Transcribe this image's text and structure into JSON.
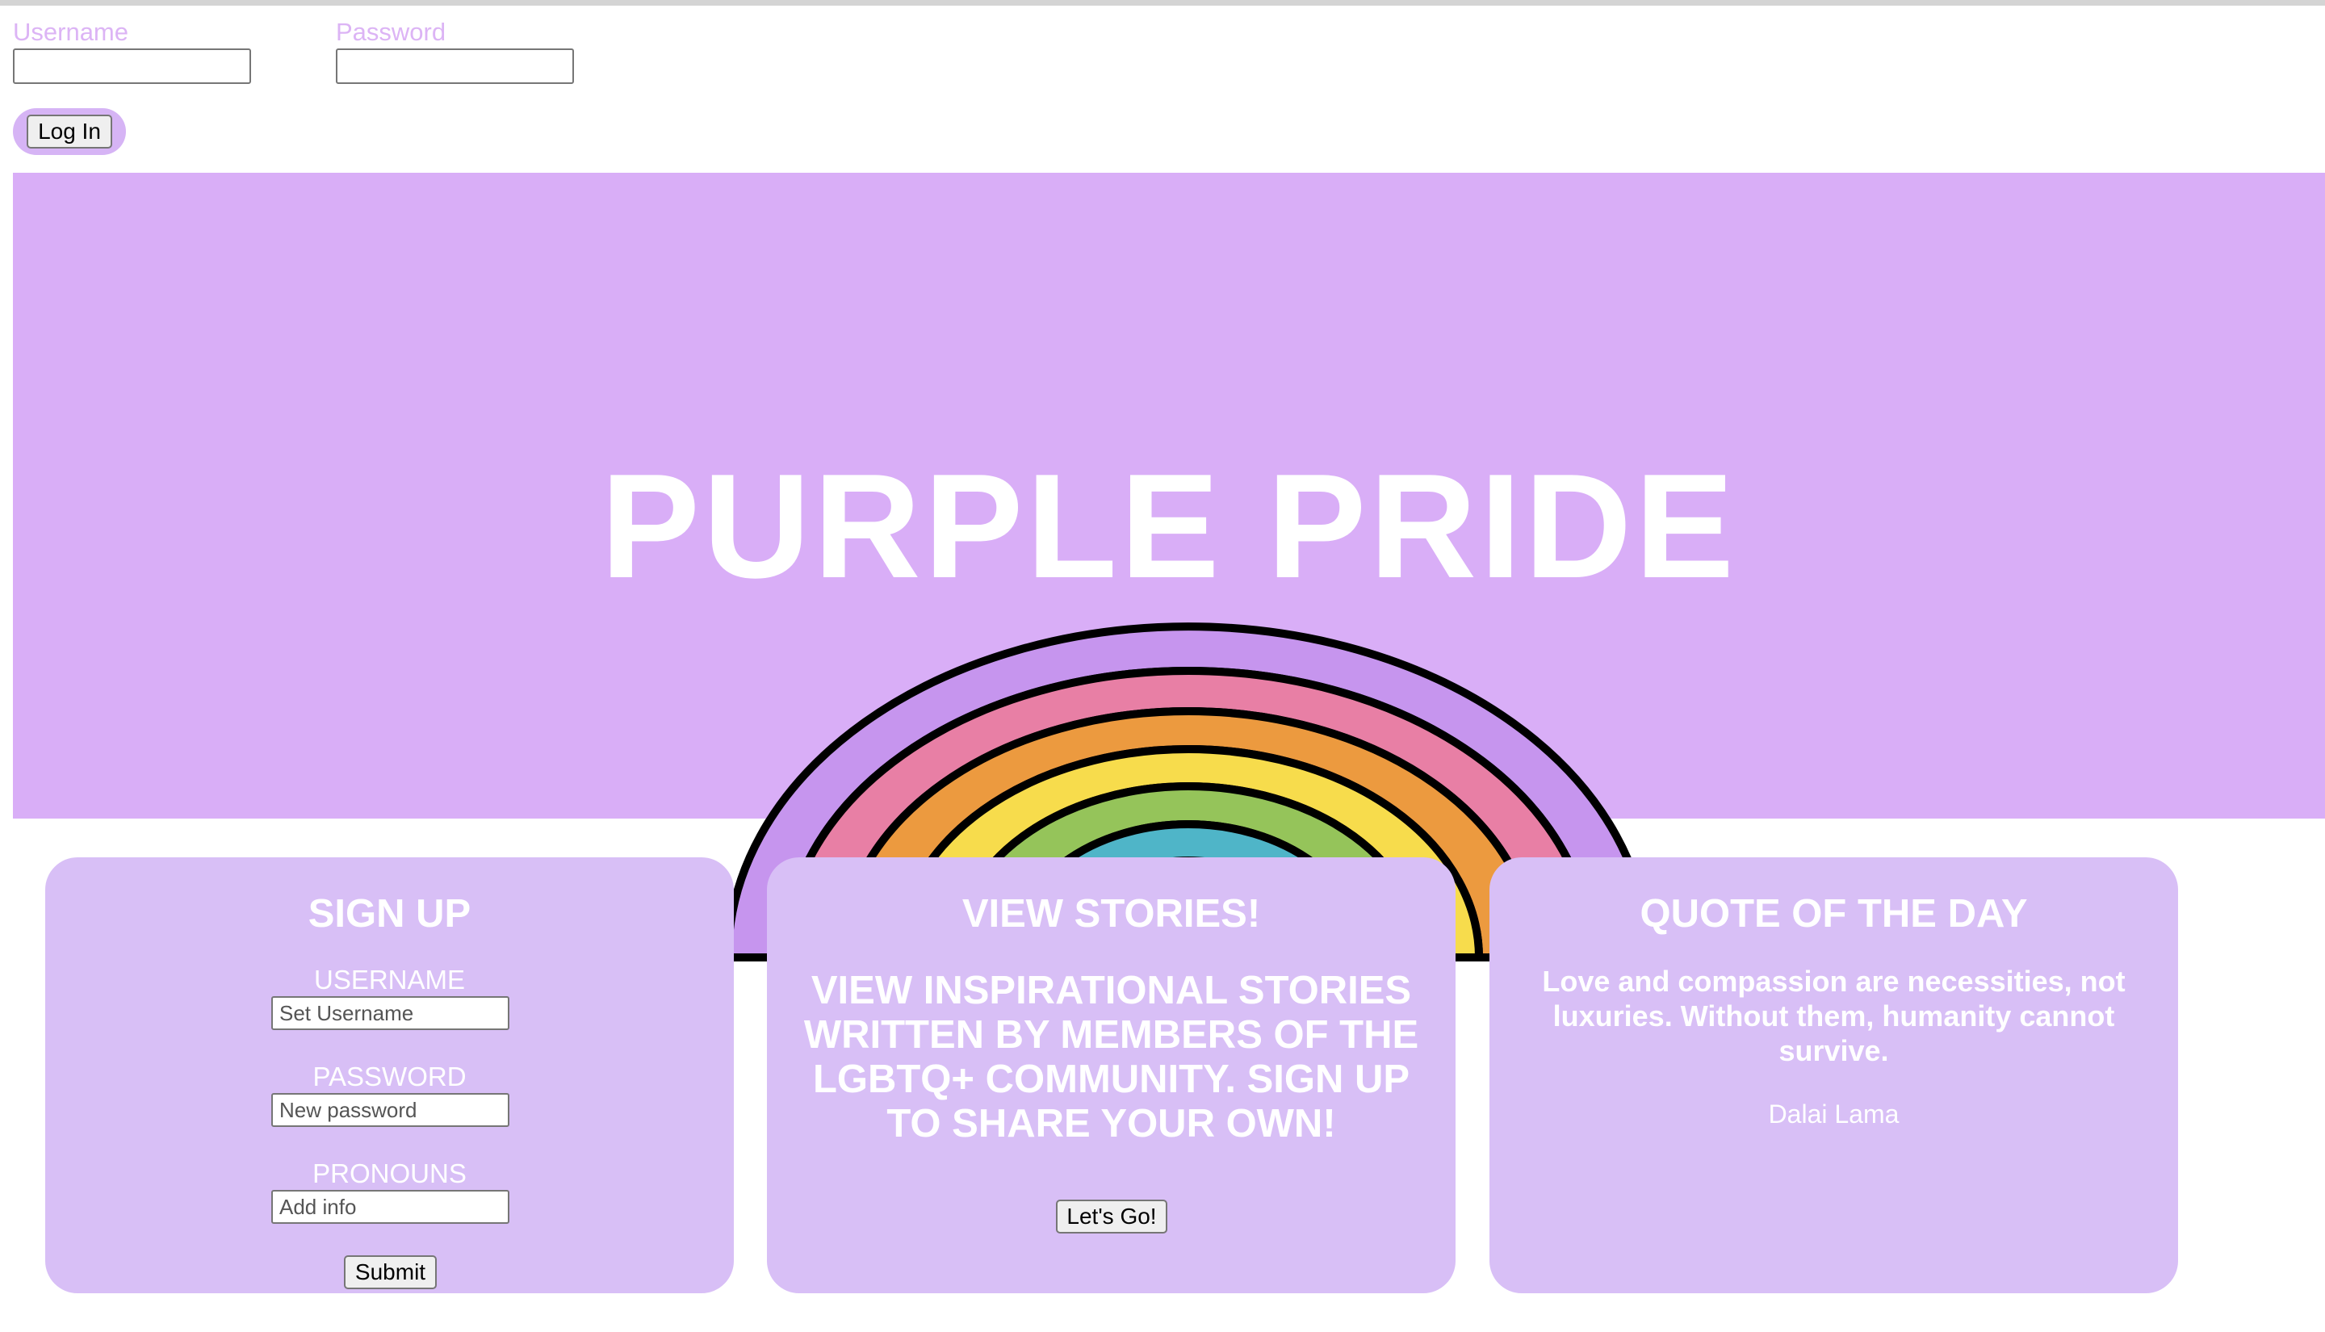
{
  "login": {
    "username_label": "Username",
    "password_label": "Password",
    "username_value": "",
    "password_value": "",
    "login_button": "Log In"
  },
  "hero": {
    "title": "PURPLE PRIDE",
    "image_icon": "rainbow-icon",
    "background_color": "#d9aef7"
  },
  "signup": {
    "title": "SIGN UP",
    "username_label": "USERNAME",
    "username_placeholder": "Set Username",
    "password_label": "PASSWORD",
    "password_placeholder": "New password",
    "pronouns_label": "PRONOUNS",
    "pronouns_placeholder": "Add info",
    "submit_button": "Submit"
  },
  "stories": {
    "title": "VIEW STORIES!",
    "text": "VIEW INSPIRATIONAL STORIES WRITTEN BY MEMBERS OF THE LGBTQ+ COMMUNITY. SIGN UP TO SHARE YOUR OWN!",
    "button": "Let's Go!"
  },
  "quote": {
    "title": "QUOTE OF THE DAY",
    "text": "Love and compassion are necessities, not luxuries. Without them, humanity cannot survive.",
    "author": "Dalai Lama"
  },
  "colors": {
    "accent": "#d9aef7",
    "card": "#d8bff6",
    "label": "#dcb4f5"
  }
}
